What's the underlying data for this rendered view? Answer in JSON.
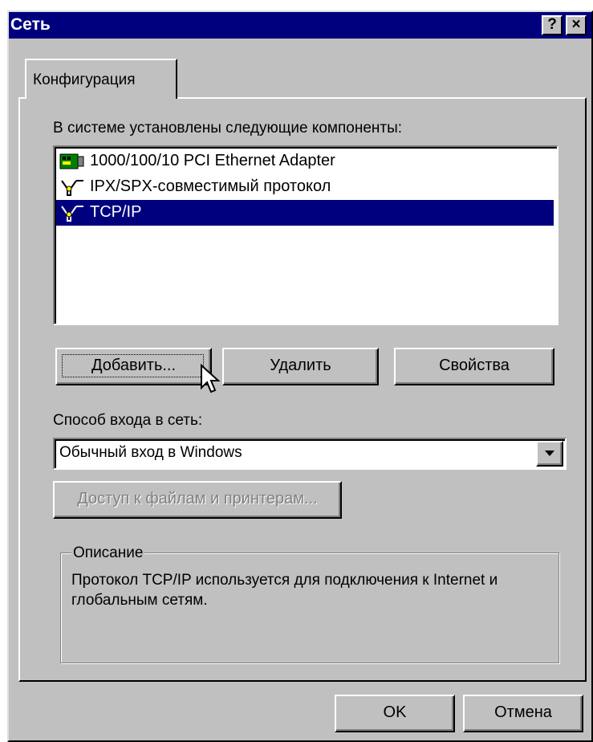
{
  "window": {
    "title": "Сеть",
    "help_label": "?",
    "close_label": "×"
  },
  "tabs": [
    {
      "label": "Конфигурация"
    }
  ],
  "components": {
    "label": "В системе установлены следующие компоненты:",
    "items": [
      {
        "label": "1000/100/10 PCI Ethernet Adapter",
        "icon": "network-adapter-icon",
        "selected": false
      },
      {
        "label": "IPX/SPX-совместимый протокол",
        "icon": "protocol-icon",
        "selected": false
      },
      {
        "label": "TCP/IP",
        "icon": "protocol-icon",
        "selected": true
      }
    ]
  },
  "buttons": {
    "add": "Добавить...",
    "remove": "Удалить",
    "properties": "Свойства"
  },
  "logon": {
    "label": "Способ входа в сеть:",
    "value": "Обычный вход в Windows"
  },
  "file_print": {
    "label": "Доступ к файлам и принтерам..."
  },
  "description": {
    "legend": "Описание",
    "text": "Протокол TCP/IP используется для подключения к Internet и глобальным сетям."
  },
  "footer": {
    "ok": "OK",
    "cancel": "Отмена"
  },
  "colors": {
    "face": "#c0c0c0",
    "titlebar": "#00007f",
    "selection": "#00007f"
  }
}
